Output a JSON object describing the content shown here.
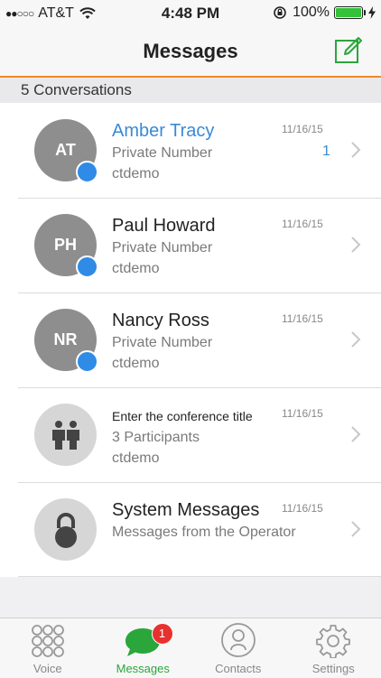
{
  "status_bar": {
    "signal_dots": "●●○○○",
    "carrier": "AT&T",
    "time": "4:48 PM",
    "battery_percent": "100%",
    "battery_level": 1.0
  },
  "nav": {
    "title": "Messages",
    "compose_icon": "compose-icon"
  },
  "section": {
    "header": "5 Conversations"
  },
  "conversations": [
    {
      "initials": "AT",
      "name": "Amber Tracy",
      "line2": "Private Number",
      "line3": "ctdemo",
      "date": "11/16/15",
      "unread": "1"
    },
    {
      "initials": "PH",
      "name": "Paul Howard",
      "line2": "Private Number",
      "line3": "ctdemo",
      "date": "11/16/15"
    },
    {
      "initials": "NR",
      "name": "Nancy Ross",
      "line2": "Private Number",
      "line3": "ctdemo",
      "date": "11/16/15"
    },
    {
      "name": "Enter the conference title",
      "line2": "3 Participants",
      "line3": "ctdemo",
      "date": "11/16/15",
      "icon": "group-icon"
    },
    {
      "name": "System Messages",
      "line2": "Messages from the Operator",
      "date": "11/16/15",
      "icon": "lock-icon"
    }
  ],
  "tabs": [
    {
      "label": "Voice",
      "icon": "keypad-icon"
    },
    {
      "label": "Messages",
      "icon": "chat-bubble-icon",
      "badge": "1"
    },
    {
      "label": "Contacts",
      "icon": "person-icon"
    },
    {
      "label": "Settings",
      "icon": "gear-icon"
    }
  ],
  "colors": {
    "accent_orange": "#f08a24",
    "link_blue": "#3a8ad6",
    "presence_blue": "#2f8be6",
    "active_green": "#2aa63b",
    "badge_red": "#e8312f"
  }
}
